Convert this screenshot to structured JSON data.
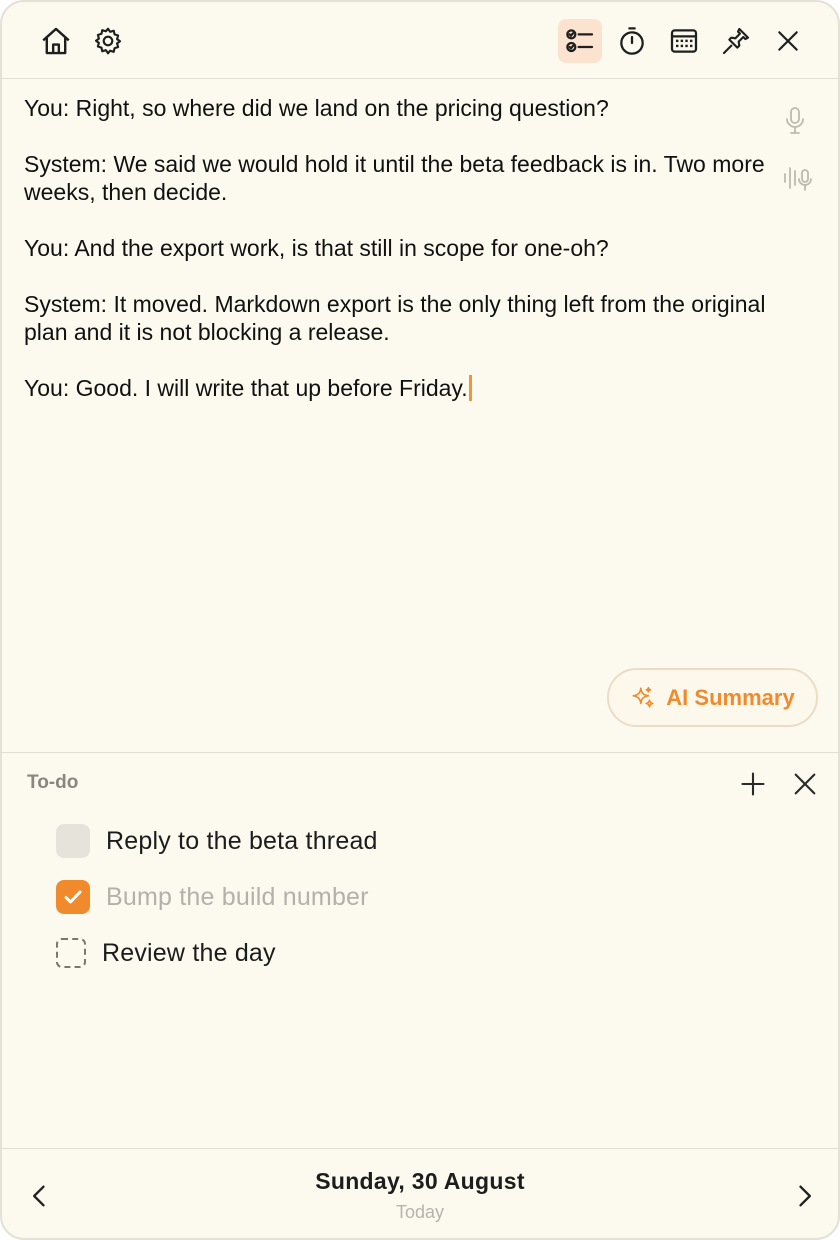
{
  "toolbar": {
    "left_icons": [
      "home-icon",
      "gear-icon"
    ],
    "right_icons": [
      "checklist-icon",
      "stopwatch-icon",
      "calendar-icon",
      "pin-icon",
      "close-icon"
    ],
    "active": "checklist-icon",
    "accent_color": "#f08a2c"
  },
  "transcript": {
    "lines": [
      "You: Right, so where did we land on the pricing question?",
      "System: We said we would hold it until the beta feedback is in. Two more\nweeks, then decide.",
      "You: And the export work, is that still in scope for one-oh?",
      "System: It moved. Markdown export is the only thing left from the original\nplan and it is not blocking a release.",
      "You: Good. I will write that up before Friday."
    ],
    "ai_summary_label": "AI Summary"
  },
  "todo": {
    "title": "To-do",
    "items": [
      {
        "label": "Reply to the beta thread",
        "state": "unchecked"
      },
      {
        "label": "Bump the build number",
        "state": "checked"
      },
      {
        "label": "Review the day",
        "state": "placeholder"
      }
    ]
  },
  "footer": {
    "date": "Sunday, 30 August",
    "relative": "Today"
  }
}
